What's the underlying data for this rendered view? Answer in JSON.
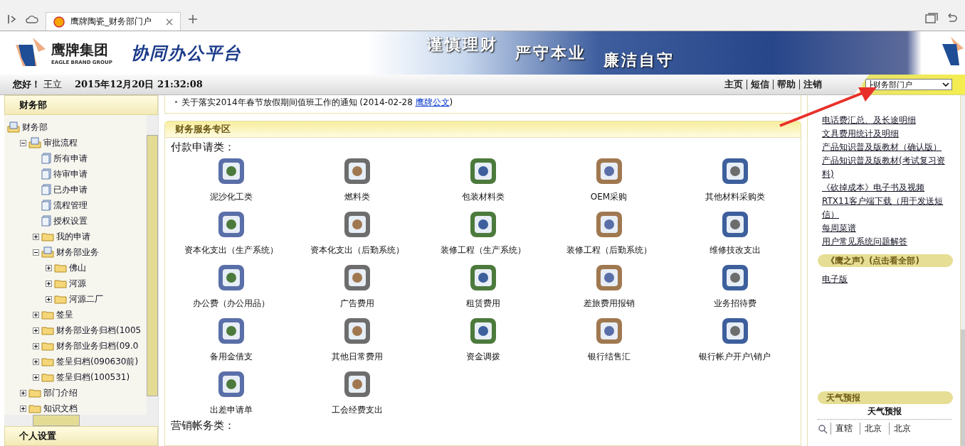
{
  "browser": {
    "tab_title": "鹰牌陶瓷_财务部门户"
  },
  "banner": {
    "logo_name": "鹰牌集团",
    "logo_subtitle": "EAGLE BRAND GROUP",
    "platform_title": "协同办公平台",
    "slogans": [
      "谨慎理财",
      "严守本业",
      "廉洁自守"
    ]
  },
  "info_bar": {
    "greeting": "您好！",
    "user": "王立",
    "datetime": "2015年12月20日 21:32:08",
    "links": [
      "主页",
      "短信",
      "帮助",
      "注销"
    ],
    "portal_select": "├财务部门户"
  },
  "sidebar": {
    "title": "财务部",
    "tree": [
      {
        "label": "财务部",
        "kind": "book",
        "children": [
          {
            "label": "审批流程",
            "kind": "book",
            "expanded": true,
            "children": [
              {
                "label": "所有申请",
                "kind": "doc"
              },
              {
                "label": "待审申请",
                "kind": "doc"
              },
              {
                "label": "已办申请",
                "kind": "doc"
              },
              {
                "label": "流程管理",
                "kind": "doc"
              },
              {
                "label": "授权设置",
                "kind": "doc"
              },
              {
                "label": "我的申请",
                "kind": "folder",
                "expanded": false
              },
              {
                "label": "财务部业务",
                "kind": "book",
                "expanded": true,
                "children": [
                  {
                    "label": "佛山",
                    "kind": "folder",
                    "expanded": false
                  },
                  {
                    "label": "河源",
                    "kind": "folder",
                    "expanded": false
                  },
                  {
                    "label": "河源二厂",
                    "kind": "folder",
                    "expanded": false
                  }
                ]
              },
              {
                "label": "签呈",
                "kind": "folder",
                "expanded": false
              },
              {
                "label": "财务部业务归档(1005",
                "kind": "folder",
                "expanded": false
              },
              {
                "label": "财务部业务归档(09.0",
                "kind": "folder",
                "expanded": false
              },
              {
                "label": "签呈归档(090630前)",
                "kind": "folder",
                "expanded": false
              },
              {
                "label": "签呈归档(100531)",
                "kind": "folder",
                "expanded": false
              }
            ]
          },
          {
            "label": "部门介绍",
            "kind": "folder",
            "expanded": false
          },
          {
            "label": "知识文档",
            "kind": "folder",
            "expanded": false
          }
        ]
      }
    ],
    "next_section": "个人设置"
  },
  "notice": {
    "text": "关于落实2014年春节放假期间值班工作的通知 (2014-02-28 ",
    "source": "鹰牌公文",
    "close": ")"
  },
  "service_zone": {
    "title": "财务服务专区",
    "sections": [
      {
        "heading": "付款申请类：",
        "items": [
          "泥沙化工类",
          "燃料类",
          "包装材料类",
          "OEM采购",
          "其他材料采购类",
          "资本化支出（生产系统）",
          "资本化支出（后勤系统）",
          "装修工程（生产系统）",
          "装修工程（后勤系统）",
          "维修技改支出",
          "办公费（办公用品）",
          "广告费用",
          "租赁费用",
          "差旅费用报销",
          "业务招待费",
          "备用金借支",
          "其他日常费用",
          "资金调拨",
          "银行结售汇",
          "银行帐户开户\\销户",
          "出差申请单",
          "工会经费支出"
        ]
      },
      {
        "heading": "营销帐务类："
      }
    ]
  },
  "right_panel": {
    "links": [
      "电话费汇总、及长途明细",
      "文具费用统计及明细",
      "产品知识普及版教材（确认版）",
      "产品知识普及版教材(考试复习资料)",
      "《砍掉成本》电子书及视频",
      "RTX11客户端下载（用于发送短信）",
      "每周菜谱",
      "用户常见系统问题解答"
    ],
    "voice_header": "《鹰之声》(点击看全部)",
    "voice_links": [
      "电子版"
    ],
    "weather": {
      "header": "天气预报",
      "title": "天气预报",
      "selects": [
        "直辖",
        "北京",
        "北京"
      ]
    }
  }
}
